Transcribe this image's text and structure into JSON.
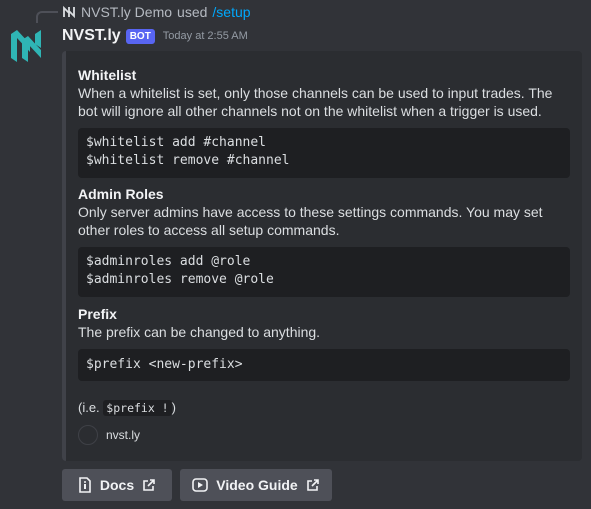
{
  "reply": {
    "user": "NVST.ly Demo",
    "verb": "used",
    "command": "/setup"
  },
  "message": {
    "username": "NVST.ly",
    "badge": "BOT",
    "timestamp": "Today at 2:55 AM"
  },
  "embed": {
    "sections": [
      {
        "title": "Whitelist",
        "text": "When a whitelist is set, only those channels can be used to input trades. The bot will ignore all other channels not on the whitelist when a trigger is used.",
        "code": [
          "$whitelist add #channel",
          "$whitelist remove #channel"
        ]
      },
      {
        "title": "Admin Roles",
        "text": "Only server admins have access to these settings commands. You may set other roles to access all setup commands.",
        "code": [
          "$adminroles add @role",
          "$adminroles remove @role"
        ]
      },
      {
        "title": "Prefix",
        "text": "The prefix can be changed to anything.",
        "code": [
          "$prefix <new-prefix>"
        ]
      }
    ],
    "example_prefix": "(i.e.",
    "example_code": "$prefix !",
    "example_suffix": ")",
    "footer_text": "nvst.ly"
  },
  "buttons": {
    "docs": {
      "label": "Docs",
      "icon": "document-icon"
    },
    "video": {
      "label": "Video Guide",
      "icon": "play-icon"
    }
  },
  "colors": {
    "background": "#313338",
    "embed": "#2b2d31",
    "accent_link": "#00a8fc",
    "bot_badge": "#5865f2",
    "logo": "#2fb5b5"
  }
}
